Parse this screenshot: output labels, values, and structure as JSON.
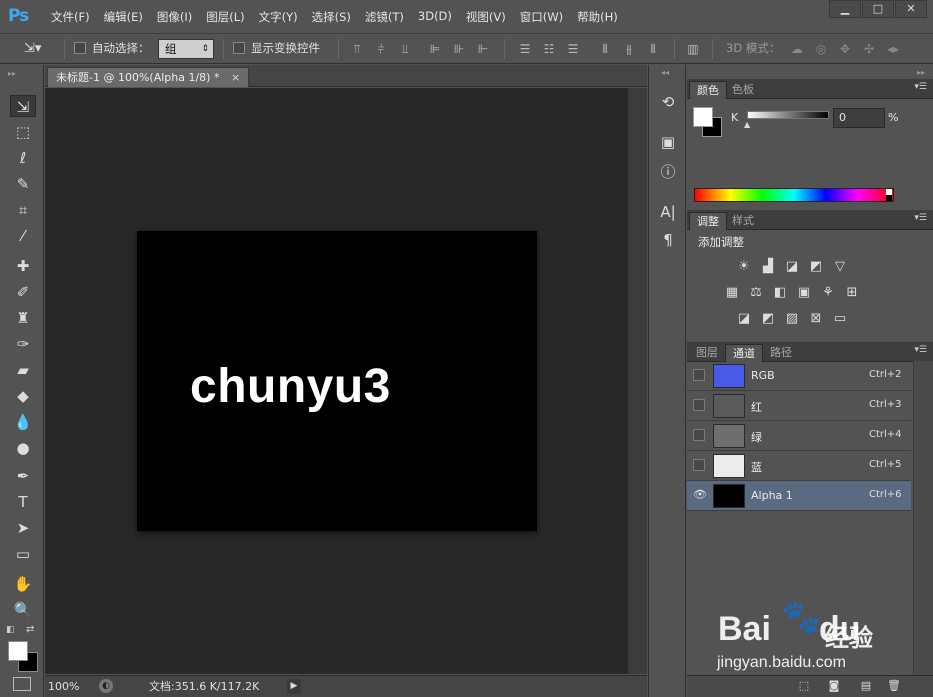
{
  "app": {
    "logo": "Ps"
  },
  "menu": [
    "文件(F)",
    "编辑(E)",
    "图像(I)",
    "图层(L)",
    "文字(Y)",
    "选择(S)",
    "滤镜(T)",
    "3D(D)",
    "视图(V)",
    "窗口(W)",
    "帮助(H)"
  ],
  "window_controls": {
    "minimize": "▁",
    "maximize": "□",
    "close": "✕"
  },
  "options": {
    "auto_select_label": "自动选择：",
    "auto_select_checked": false,
    "group_value": "组",
    "show_transform_label": "显示变换控件",
    "show_transform_checked": false,
    "mode_3d_label": "3D 模式："
  },
  "document": {
    "tab_title": "未标题-1 @ 100%(Alpha 1/8) *",
    "tab_close": "×",
    "canvas_text": "chunyu3",
    "canvas_color": "#000000",
    "text_color": "#ffffff"
  },
  "status": {
    "zoom": "100%",
    "doc_size": "文档:351.6 K/117.2K",
    "arrow": "▶"
  },
  "panels": {
    "color": {
      "tabs": [
        "颜色",
        "色板"
      ],
      "channel_label": "K",
      "value": "0",
      "unit": "%",
      "foreground": "#ffffff",
      "background": "#000000"
    },
    "adjustments": {
      "tabs": [
        "调整",
        "样式"
      ],
      "title": "添加调整"
    },
    "channels": {
      "tabs": [
        "图层",
        "通道",
        "路径"
      ],
      "rows": [
        {
          "name": "RGB",
          "shortcut": "Ctrl+2",
          "thumb": "#4a5ae8",
          "visible": false,
          "selected": false
        },
        {
          "name": "红",
          "shortcut": "Ctrl+3",
          "thumb": "#5a5a5a",
          "visible": false,
          "selected": false
        },
        {
          "name": "绿",
          "shortcut": "Ctrl+4",
          "thumb": "#6e6e6e",
          "visible": false,
          "selected": false
        },
        {
          "name": "蓝",
          "shortcut": "Ctrl+5",
          "thumb": "#ececec",
          "visible": false,
          "selected": false
        },
        {
          "name": "Alpha 1",
          "shortcut": "Ctrl+6",
          "thumb": "#000000",
          "visible": true,
          "selected": true
        }
      ]
    }
  },
  "watermark": {
    "brand_left": "Bai",
    "brand_right": "du",
    "product": "经验",
    "url": "jingyan.baidu.com"
  }
}
